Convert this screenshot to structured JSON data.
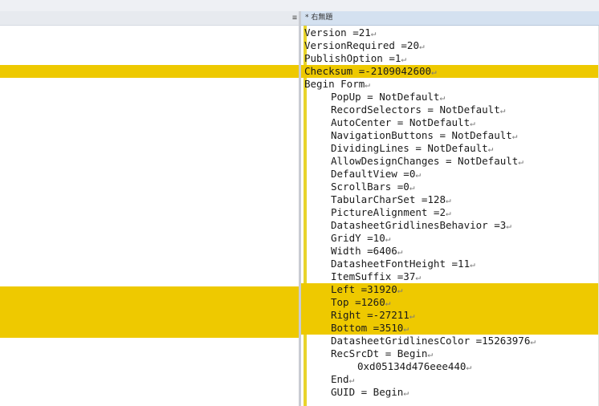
{
  "left_panel": {
    "menu_icon": "≡"
  },
  "tab": {
    "title": "* 右無題"
  },
  "eol_glyph": "↵",
  "editor": {
    "lines": [
      {
        "text": "Version =21",
        "indent": 0,
        "highlight": false
      },
      {
        "text": "VersionRequired =20",
        "indent": 0,
        "highlight": false
      },
      {
        "text": "PublishOption =1",
        "indent": 0,
        "highlight": false
      },
      {
        "text": "Checksum =-2109042600",
        "indent": 0,
        "highlight": true
      },
      {
        "text": "Begin Form",
        "indent": 0,
        "highlight": false
      },
      {
        "text": "PopUp = NotDefault",
        "indent": 1,
        "highlight": false
      },
      {
        "text": "RecordSelectors = NotDefault",
        "indent": 1,
        "highlight": false
      },
      {
        "text": "AutoCenter = NotDefault",
        "indent": 1,
        "highlight": false
      },
      {
        "text": "NavigationButtons = NotDefault",
        "indent": 1,
        "highlight": false
      },
      {
        "text": "DividingLines = NotDefault",
        "indent": 1,
        "highlight": false
      },
      {
        "text": "AllowDesignChanges = NotDefault",
        "indent": 1,
        "highlight": false
      },
      {
        "text": "DefaultView =0",
        "indent": 1,
        "highlight": false
      },
      {
        "text": "ScrollBars =0",
        "indent": 1,
        "highlight": false
      },
      {
        "text": "TabularCharSet =128",
        "indent": 1,
        "highlight": false
      },
      {
        "text": "PictureAlignment =2",
        "indent": 1,
        "highlight": false
      },
      {
        "text": "DatasheetGridlinesBehavior =3",
        "indent": 1,
        "highlight": false
      },
      {
        "text": "GridY =10",
        "indent": 1,
        "highlight": false
      },
      {
        "text": "Width =6406",
        "indent": 1,
        "highlight": false
      },
      {
        "text": "DatasheetFontHeight =11",
        "indent": 1,
        "highlight": false
      },
      {
        "text": "ItemSuffix =37",
        "indent": 1,
        "highlight": false
      },
      {
        "text": "Left =31920",
        "indent": 1,
        "highlight": true
      },
      {
        "text": "Top =1260",
        "indent": 1,
        "highlight": true
      },
      {
        "text": "Right =-27211",
        "indent": 1,
        "highlight": true
      },
      {
        "text": "Bottom =3510",
        "indent": 1,
        "highlight": true
      },
      {
        "text": "DatasheetGridlinesColor =15263976",
        "indent": 1,
        "highlight": false
      },
      {
        "text": "RecSrcDt = Begin",
        "indent": 1,
        "highlight": false
      },
      {
        "text": "0xd05134d476eee440",
        "indent": 2,
        "highlight": false
      },
      {
        "text": "End",
        "indent": 1,
        "highlight": false
      },
      {
        "text": "GUID = Begin",
        "indent": 1,
        "highlight": false
      }
    ]
  },
  "colors": {
    "highlight": "#eec900",
    "tab_header": "#d4e1f0"
  }
}
